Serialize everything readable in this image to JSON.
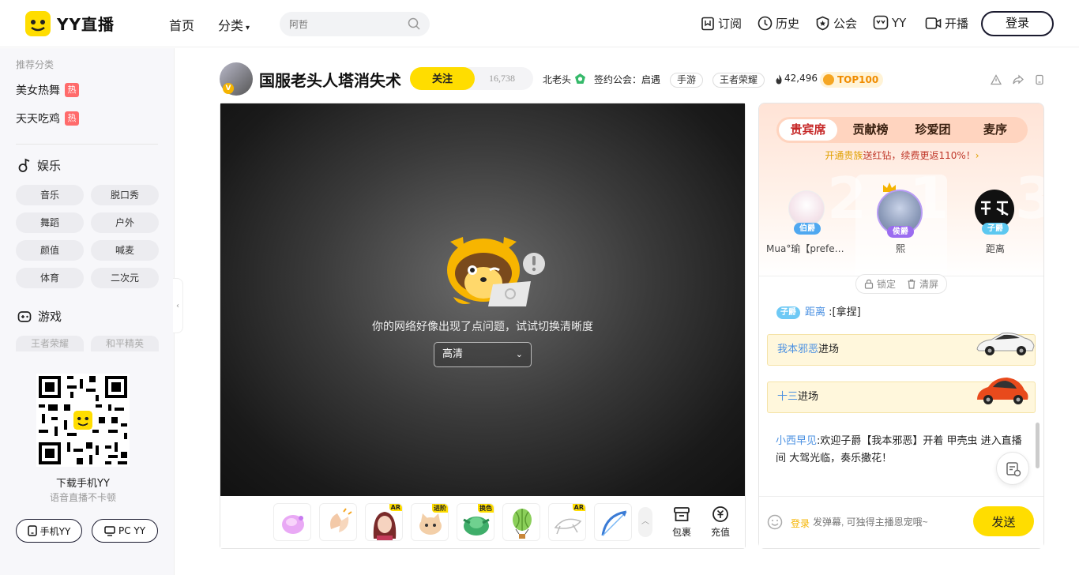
{
  "header": {
    "logo_text": "YY直播",
    "nav_home": "首页",
    "nav_category": "分类",
    "search_placeholder": "阿哲",
    "subscribe": "订阅",
    "history": "历史",
    "guild": "公会",
    "yy": "YY",
    "broadcast": "开播",
    "login": "登录"
  },
  "sidebar": {
    "recommend_title": "推荐分类",
    "recommend": [
      {
        "label": "美女热舞",
        "badge": "热"
      },
      {
        "label": "天天吃鸡",
        "badge": "热"
      }
    ],
    "entertainment_title": "娱乐",
    "entertainment_pills": [
      "音乐",
      "脱口秀",
      "舞蹈",
      "户外",
      "颜值",
      "喊麦",
      "体育",
      "二次元"
    ],
    "game_title": "游戏",
    "game_pills": [
      "王者荣耀",
      "和平精英"
    ],
    "download_title": "下载手机YY",
    "download_sub": "语音直播不卡顿",
    "mobile_btn": "手机YY",
    "pc_btn": "PC YY"
  },
  "room": {
    "title": "国服老头人塔消失术",
    "follow": "关注",
    "follow_count": "16,738",
    "host_name": "北老头",
    "guild_label": "签约公会：启遇",
    "tags": [
      "手游",
      "王者荣耀"
    ],
    "heat": "42,496",
    "top_badge": "TOP100"
  },
  "player": {
    "error_text": "你的网络好像出现了点问题，试试切换清晰度",
    "quality": "高清",
    "gift_badges": [
      "AR",
      "进阶",
      "换色",
      "AR"
    ],
    "bag": "包裹",
    "recharge": "充值"
  },
  "panel": {
    "tabs": [
      "贵宾席",
      "贡献榜",
      "珍爱团",
      "麦序"
    ],
    "promo_highlight": "开通贵族",
    "promo_rest": "送红钻，续费更返110%！",
    "rank_numbers": [
      "2",
      "1",
      "3"
    ],
    "seats": [
      {
        "name": "Mua°瑜【prefere…",
        "rank": "伯爵",
        "color": "#4fa8f0"
      },
      {
        "name": "熙",
        "rank": "侯爵",
        "color": "#9b6cf0"
      },
      {
        "name": "距离",
        "rank": "子爵",
        "color": "#5cc8f0"
      }
    ],
    "lock": "锁定",
    "clear": "清屏",
    "chat": [
      {
        "tag": "子爵",
        "user": "距离",
        "text": ":[拿捏]"
      }
    ],
    "entries": [
      {
        "user": "我本邪恶",
        "text": "进场",
        "car": "white"
      },
      {
        "user": "十三",
        "text": "进场",
        "car": "red"
      }
    ],
    "message": {
      "user": "小西早见",
      "text": ":欢迎子爵【我本邪恶】开着 甲壳虫 进入直播间 大驾光临，奏乐撒花！"
    },
    "input_login": "登录",
    "input_placeholder": "发弹幕, 可独得主播恩宠哦~",
    "send": "发送"
  }
}
